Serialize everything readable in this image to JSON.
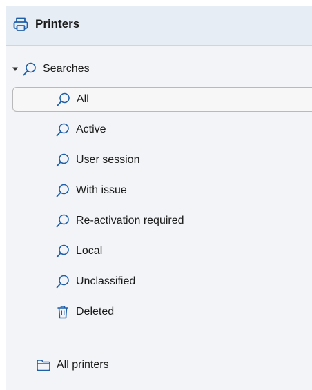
{
  "panel": {
    "title": "Printers",
    "icon": "printer-icon"
  },
  "tree": {
    "searches_group": {
      "label": "Searches",
      "expanded": true,
      "icon": "search-icon"
    },
    "search_items": [
      {
        "label": "All",
        "icon": "search-icon",
        "selected": true
      },
      {
        "label": "Active",
        "icon": "search-icon"
      },
      {
        "label": "User session",
        "icon": "search-icon"
      },
      {
        "label": "With issue",
        "icon": "search-icon"
      },
      {
        "label": "Re-activation required",
        "icon": "search-icon"
      },
      {
        "label": "Local",
        "icon": "search-icon"
      },
      {
        "label": "Unclassified",
        "icon": "search-icon"
      },
      {
        "label": "Deleted",
        "icon": "trash-icon"
      }
    ],
    "folders": [
      {
        "label": "All printers",
        "icon": "folder-icon"
      }
    ]
  },
  "colors": {
    "accent": "#1f5fa8",
    "header_bg": "#e7edf5",
    "panel_bg": "#f2f4f7",
    "selection_border": "#b9b9b9"
  }
}
